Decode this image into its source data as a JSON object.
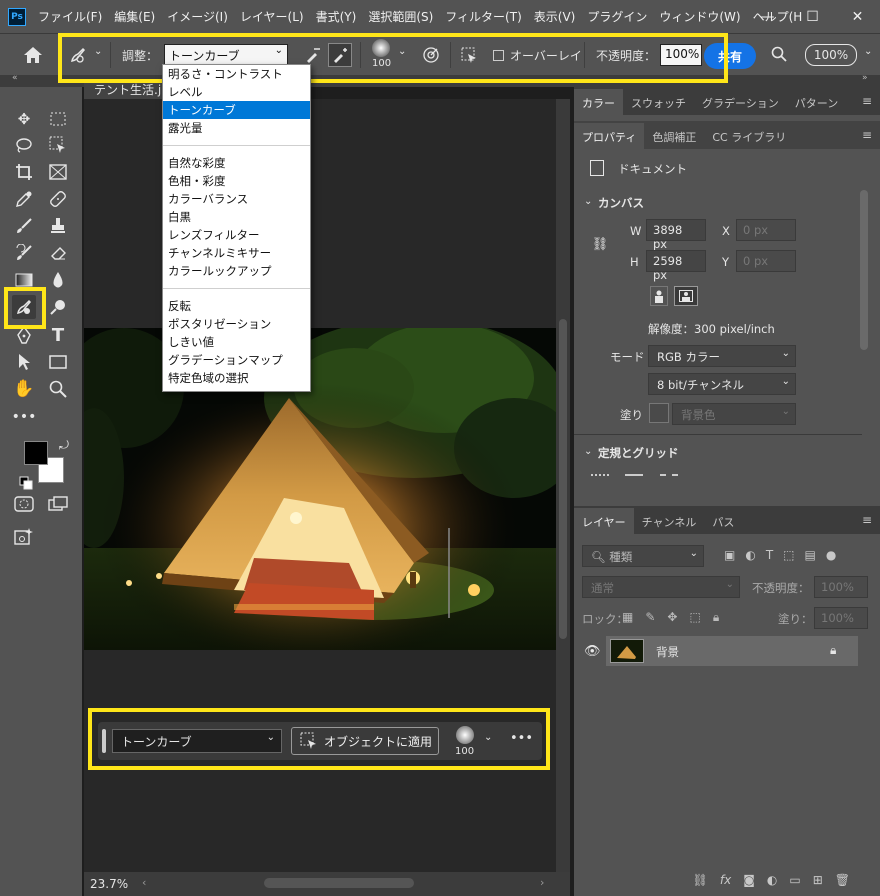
{
  "menu": {
    "items": [
      "ファイル(F)",
      "編集(E)",
      "イメージ(I)",
      "レイヤー(L)",
      "書式(Y)",
      "選択範囲(S)",
      "フィルター(T)",
      "表示(V)",
      "プラグイン",
      "ウィンドウ(W)",
      "ヘルプ(H"
    ],
    "logo": "Ps"
  },
  "options": {
    "adjust_label": "調整：",
    "adjust_value": "トーンカーブ",
    "brush_size": "100",
    "overlay_label": "オーバーレイ",
    "opacity_label": "不透明度：",
    "opacity_value": "100%",
    "share_label": "共有",
    "zoom_value": "100%"
  },
  "doc": {
    "tab_title": "テント生活.jpeg",
    "zoom": "23.7%"
  },
  "dropdown": {
    "group1": [
      "明るさ・コントラスト",
      "レベル",
      "トーンカーブ",
      "露光量"
    ],
    "group2": [
      "自然な彩度",
      "色相・彩度",
      "カラーバランス",
      "白黒",
      "レンズフィルター",
      "チャンネルミキサー",
      "カラールックアップ"
    ],
    "group3": [
      "反転",
      "ポスタリゼーション",
      "しきい値",
      "グラデーションマップ",
      "特定色域の選択"
    ],
    "selected": "トーンカーブ"
  },
  "taskbar": {
    "select_value": "トーンカーブ",
    "apply_label": "オブジェクトに適用",
    "brush_size": "100",
    "more": "•••"
  },
  "panels": {
    "top_tabs": [
      "カラー",
      "スウォッチ",
      "グラデーション",
      "パターン"
    ],
    "prop_tabs": [
      "プロパティ",
      "色調補正",
      "CC ライブラリ"
    ],
    "doc_label": "ドキュメント",
    "canvas_section": "カンバス",
    "w_label": "W",
    "w_value": "3898 px",
    "h_label": "H",
    "h_value": "2598 px",
    "x_label": "X",
    "x_value": "0 px",
    "y_label": "Y",
    "y_value": "0 px",
    "resolution": "解像度：300 pixel/inch",
    "mode_label": "モード",
    "mode_value": "RGB カラー",
    "bit_value": "8 bit/チャンネル",
    "fill_label": "塗り",
    "fill_value": "背景色",
    "rulers_section": "定規とグリッド",
    "layer_tabs": [
      "レイヤー",
      "チャンネル",
      "パス"
    ],
    "kind_placeholder": "種類",
    "blend_value": "通常",
    "opacity_label": "不透明度：",
    "opacity_value": "100%",
    "lock_label": "ロック：",
    "fill_label2": "塗り：",
    "fill_value2": "100%",
    "layer_name": "背景"
  },
  "colors": {
    "highlight": "#ffe619",
    "accent": "#1473e6",
    "selection": "#0078d7"
  }
}
